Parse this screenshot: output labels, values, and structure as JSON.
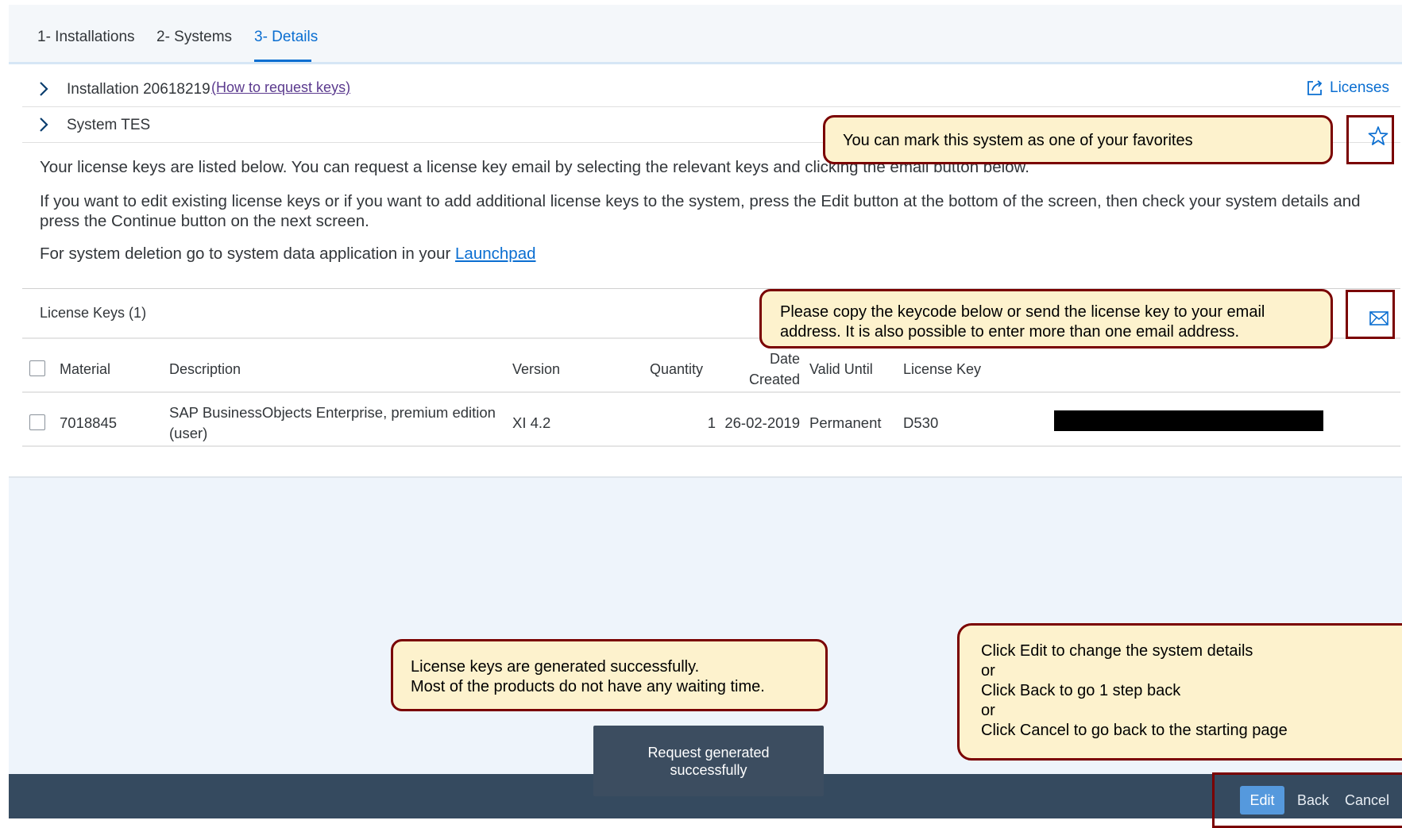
{
  "tabs": [
    {
      "label": "1- Installations"
    },
    {
      "label": "2- Systems"
    },
    {
      "label": "3- Details"
    }
  ],
  "installation": {
    "title": "Installation 20618219",
    "howto_link": "(How to request keys)",
    "licenses_link": "Licenses"
  },
  "system": {
    "title": "System TES"
  },
  "info": {
    "line1": "Your license keys are listed below. You can request a license key email by selecting the relevant keys and clicking the email button below.",
    "line2": "If you want to edit existing license keys or if you want to add additional license keys to the system, press the Edit button at the bottom of the screen, then check your system details and press the Continue button on the next screen.",
    "line3_prefix": "For system deletion go to system data application in your",
    "line3_link": "Launchpad"
  },
  "license_keys": {
    "title": "License Keys (1)",
    "columns": {
      "material": "Material",
      "description": "Description",
      "version": "Version",
      "quantity": "Quantity",
      "date_created_1": "Date",
      "date_created_2": "Created",
      "valid_until": "Valid Until",
      "license_key": "License Key"
    },
    "rows": [
      {
        "material": "7018845",
        "description_1": "SAP BusinessObjects Enterprise, premium edition",
        "description_2": "(user)",
        "version": "XI 4.2",
        "quantity": "1",
        "date_created": "26-02-2019",
        "valid_until": "Permanent",
        "license_key": "D530"
      }
    ]
  },
  "toast": {
    "text": "Request generated successfully"
  },
  "footer": {
    "edit": "Edit",
    "back": "Back",
    "cancel": "Cancel"
  },
  "callouts": {
    "favorites": "You can mark this system as one of your favorites",
    "email": "Please copy the keycode below or send the license key to your email\naddress. It is also possible to enter more than one email address.",
    "generated": "License keys are generated successfully.\nMost of the products do not have any waiting time.",
    "navigation": "Click Edit to change the system details\nor\nClick Back to go 1 step back\nor\nClick Cancel to go back to the starting page"
  },
  "colors": {
    "accent": "#0a6ed1",
    "footer": "#354a5f",
    "callout_fill": "#fdf2cd",
    "callout_border": "#7a0000"
  },
  "icons": [
    "chevron-right-icon",
    "external-link-icon",
    "star-icon",
    "envelope-icon"
  ]
}
